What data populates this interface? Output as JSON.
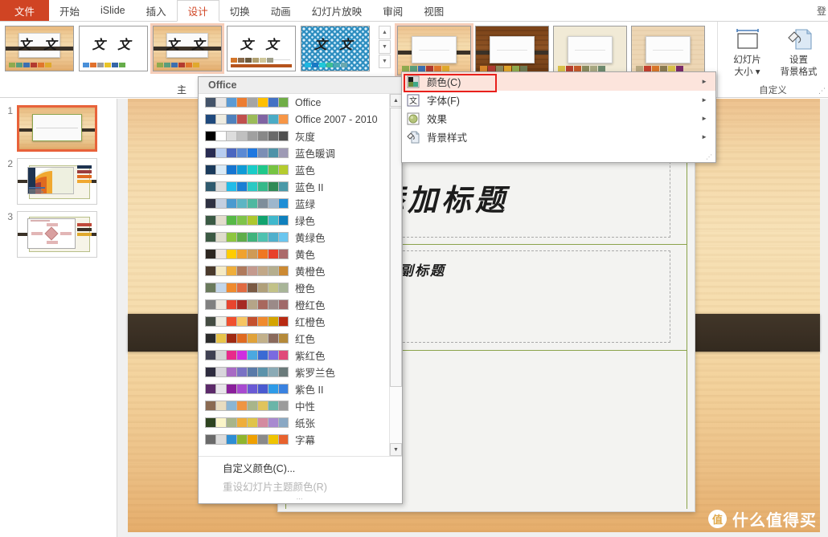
{
  "window": {
    "signin_partial": "登"
  },
  "ribbon_tabs": [
    {
      "label": "文件",
      "type": "file"
    },
    {
      "label": "开始",
      "type": "normal"
    },
    {
      "label": "iSlide",
      "type": "normal"
    },
    {
      "label": "插入",
      "type": "normal"
    },
    {
      "label": "设计",
      "type": "active"
    },
    {
      "label": "切换",
      "type": "normal"
    },
    {
      "label": "动画",
      "type": "normal"
    },
    {
      "label": "幻灯片放映",
      "type": "normal"
    },
    {
      "label": "审阅",
      "type": "normal"
    },
    {
      "label": "视图",
      "type": "normal"
    }
  ],
  "theme_gallery": {
    "group_label": "主",
    "themes": [
      {
        "name": "theme-wood",
        "preview_text": "文 文",
        "style": "wood",
        "swatches": [
          "#8faa4e",
          "#5a9e7c",
          "#3c6fb0",
          "#b33a2f",
          "#e0762c",
          "#e0a92c"
        ]
      },
      {
        "name": "theme-white",
        "preview_text": "文 文",
        "style": "white",
        "swatches": [
          "#4a90d9",
          "#e0702c",
          "#9c9c9c",
          "#e8c428",
          "#3566a8",
          "#66ad4a"
        ]
      },
      {
        "name": "theme-wood-selected",
        "preview_text": "文 文",
        "style": "wood",
        "swatches": [
          "#8faa4e",
          "#5a9e7c",
          "#3c6fb0",
          "#b33a2f",
          "#e0762c",
          "#e0a92c"
        ]
      },
      {
        "name": "theme-plain",
        "preview_text": "文 文",
        "style": "white-rule",
        "swatches": [
          "#d4762a",
          "#8a6a4a",
          "#6b5a3e",
          "#b0a070",
          "#cfc79a",
          "#9e9e88"
        ]
      },
      {
        "name": "theme-blue-pattern",
        "preview_text": "文 文",
        "style": "blue",
        "swatches": [
          "#1fb6e0",
          "#1879c4",
          "#20c9d8",
          "#3fbf93",
          "#4aa8b5",
          "#6aa8b0"
        ]
      }
    ],
    "scroll_up": "▲",
    "scroll_down": "▼",
    "more": "▼"
  },
  "variants_gallery": [
    {
      "name": "variant-light-wood",
      "selected": true,
      "band": "#3a3127",
      "wood": "light",
      "swatches": [
        "#8faa4e",
        "#5a9e7c",
        "#3c6fb0",
        "#b33a2f",
        "#e0762c",
        "#e0a92c"
      ]
    },
    {
      "name": "variant-dark-wood",
      "selected": false,
      "band": "#3a3127",
      "wood": "dark",
      "swatches": [
        "#d8862a",
        "#b03a32",
        "#8a8a5e",
        "#e0a52c",
        "#8faa4e",
        "#6e7a52"
      ]
    },
    {
      "name": "variant-cream",
      "selected": false,
      "band": "",
      "wood": "cream",
      "swatches": [
        "#d8c04a",
        "#b8402f",
        "#c45a2a",
        "#8a8a5e",
        "#a8a882",
        "#6e8a6e"
      ]
    },
    {
      "name": "variant-tan",
      "selected": false,
      "band": "",
      "wood": "tan",
      "swatches": [
        "#b8a882",
        "#c4402f",
        "#d8762a",
        "#8a7a52",
        "#d8c04a",
        "#7a2a6a"
      ]
    }
  ],
  "customize_group": {
    "caption": "自定义",
    "buttons": [
      {
        "name": "slide-size",
        "line1": "幻灯片",
        "line2": "大小 ▾",
        "icon": "slide-size-icon"
      },
      {
        "name": "format-background",
        "line1": "设置",
        "line2": "背景格式",
        "icon": "format-background-icon"
      }
    ]
  },
  "variant_menu": {
    "items": [
      {
        "label": "颜色(C)",
        "icon": "colors-icon",
        "arrow": "►",
        "highlighted": true
      },
      {
        "label": "字体(F)",
        "icon": "fonts-icon",
        "arrow": "►",
        "highlighted": false
      },
      {
        "label": "效果",
        "icon": "effects-icon",
        "arrow": "►",
        "highlighted": false
      },
      {
        "label": "背景样式",
        "icon": "background-styles-icon",
        "arrow": "►",
        "highlighted": false
      }
    ],
    "grip": "⋰"
  },
  "color_list": {
    "header": "Office",
    "rows": [
      {
        "name": "Office",
        "colors": [
          "#44546a",
          "#e7e6e6",
          "#5b9bd5",
          "#ed7d31",
          "#a5a5a5",
          "#ffc000",
          "#4472c4",
          "#70ad47"
        ]
      },
      {
        "name": "Office 2007 - 2010",
        "colors": [
          "#1f497d",
          "#eeece1",
          "#4f81bd",
          "#c0504d",
          "#9bbb59",
          "#8064a2",
          "#4bacc6",
          "#f79646"
        ]
      },
      {
        "name": "灰度",
        "colors": [
          "#000000",
          "#ffffff",
          "#dddddd",
          "#c0c0c0",
          "#a0a0a0",
          "#888888",
          "#6a6a6a",
          "#4f4f4f"
        ]
      },
      {
        "name": "蓝色暖调",
        "colors": [
          "#282b52",
          "#b8cdf0",
          "#4a66c0",
          "#5b8ad4",
          "#1f78e0",
          "#7b8fb5",
          "#4e93a8",
          "#9e9ab5"
        ]
      },
      {
        "name": "蓝色",
        "colors": [
          "#1a3a5c",
          "#d9eaf7",
          "#1675d1",
          "#0f9bd7",
          "#19ccc8",
          "#1fc88a",
          "#76c442",
          "#b5cc2e"
        ]
      },
      {
        "name": "蓝色 II",
        "colors": [
          "#2f5a6e",
          "#dbdbdb",
          "#22bce8",
          "#1b7fd4",
          "#2bc9c4",
          "#35b98a",
          "#2f8a56",
          "#4a99a8"
        ]
      },
      {
        "name": "蓝绿",
        "colors": [
          "#2e3142",
          "#c3cfe0",
          "#4a9ad0",
          "#5cb5c4",
          "#4fb8a0",
          "#7e8e9b",
          "#9db6cc",
          "#1f8ed6"
        ]
      },
      {
        "name": "绿色",
        "colors": [
          "#3a5a44",
          "#e3ddcc",
          "#57b947",
          "#7ec44a",
          "#adc72e",
          "#10a36e",
          "#40b8cc",
          "#0f80bd"
        ]
      },
      {
        "name": "黄绿色",
        "colors": [
          "#3c5a44",
          "#e0ddcc",
          "#8dc63f",
          "#5ead4a",
          "#3fb37c",
          "#4ec2b0",
          "#4fb0cc",
          "#6ac6ef"
        ]
      },
      {
        "name": "黄色",
        "colors": [
          "#2d2620",
          "#ece3dc",
          "#ffcc00",
          "#f0a22e",
          "#cf9a56",
          "#ef7722",
          "#e8402a",
          "#ab6a6a"
        ]
      },
      {
        "name": "黄橙色",
        "colors": [
          "#4a3a2c",
          "#f5eac4",
          "#efae3b",
          "#b07a5c",
          "#c49a8e",
          "#c2a888",
          "#b5ae8e",
          "#cc8a33"
        ]
      },
      {
        "name": "橙色",
        "colors": [
          "#6a7a5c",
          "#c3d6ea",
          "#ef8a2e",
          "#e06b42",
          "#7a5a44",
          "#b0a07a",
          "#c2c288",
          "#a8b598"
        ]
      },
      {
        "name": "橙红色",
        "colors": [
          "#808080",
          "#ece7de",
          "#e8452e",
          "#a62a23",
          "#b5a588",
          "#a8685e",
          "#9b8a88",
          "#a06a6a"
        ]
      },
      {
        "name": "红橙色",
        "colors": [
          "#444c42",
          "#efece0",
          "#f0502e",
          "#f7c562",
          "#c4502e",
          "#f08a2e",
          "#d4a400",
          "#b82a12"
        ]
      },
      {
        "name": "红色",
        "colors": [
          "#2b2b2b",
          "#e8c44a",
          "#a02a12",
          "#e06a20",
          "#e0a23a",
          "#c2b08a",
          "#8a6a5c",
          "#b58a3a"
        ]
      },
      {
        "name": "紫红色",
        "colors": [
          "#3f4152",
          "#d4d4d4",
          "#e82a8a",
          "#cf2ee0",
          "#4aa8e0",
          "#3a6ad4",
          "#7a6ae0",
          "#e04a7a"
        ]
      },
      {
        "name": "紫罗兰色",
        "colors": [
          "#2e2c3f",
          "#d8d5dc",
          "#a86ac4",
          "#7a72c4",
          "#5a7aa8",
          "#5c93ab",
          "#8aaab5",
          "#6a7a7a"
        ]
      },
      {
        "name": "紫色 II",
        "colors": [
          "#5c2a6a",
          "#e8e4ea",
          "#8a1f9b",
          "#a84ad0",
          "#6a5ad4",
          "#4a5ad0",
          "#2e9be8",
          "#3a82e0"
        ]
      },
      {
        "name": "中性",
        "colors": [
          "#8a6a52",
          "#e8dcc0",
          "#8ab5d4",
          "#ef9542",
          "#a8b58a",
          "#e0c45c",
          "#6ab5a8",
          "#9b9b9b"
        ]
      },
      {
        "name": "纸张",
        "colors": [
          "#2e4420",
          "#fbf5c8",
          "#a8b58a",
          "#efae3b",
          "#e0c44a",
          "#d48aa0",
          "#a88ad0",
          "#8aa8c4"
        ]
      },
      {
        "name": "字幕",
        "colors": [
          "#6a6a6a",
          "#dcdcdc",
          "#2e8ed4",
          "#8fb52e",
          "#efa000",
          "#8a8a8a",
          "#efc400",
          "#e8622e"
        ]
      }
    ],
    "custom_color_label": "自定义颜色(C)...",
    "reset_label": "重设幻灯片主题颜色(R)",
    "grip": "⋯"
  },
  "slide_panel": {
    "slides": [
      {
        "number": "1",
        "selected": true,
        "kind": "title"
      },
      {
        "number": "2",
        "selected": false,
        "kind": "arcs"
      },
      {
        "number": "3",
        "selected": false,
        "kind": "diagram"
      }
    ]
  },
  "slide_canvas": {
    "title_placeholder": "此处添加标题",
    "subtitle_placeholder": "单击此处添加副标题",
    "background_color": "#f4d7a7",
    "band_color": "#3a3127",
    "accent_line_color": "#8ba34b"
  },
  "watermark": {
    "logo_char": "值",
    "text": "什么值得买"
  }
}
